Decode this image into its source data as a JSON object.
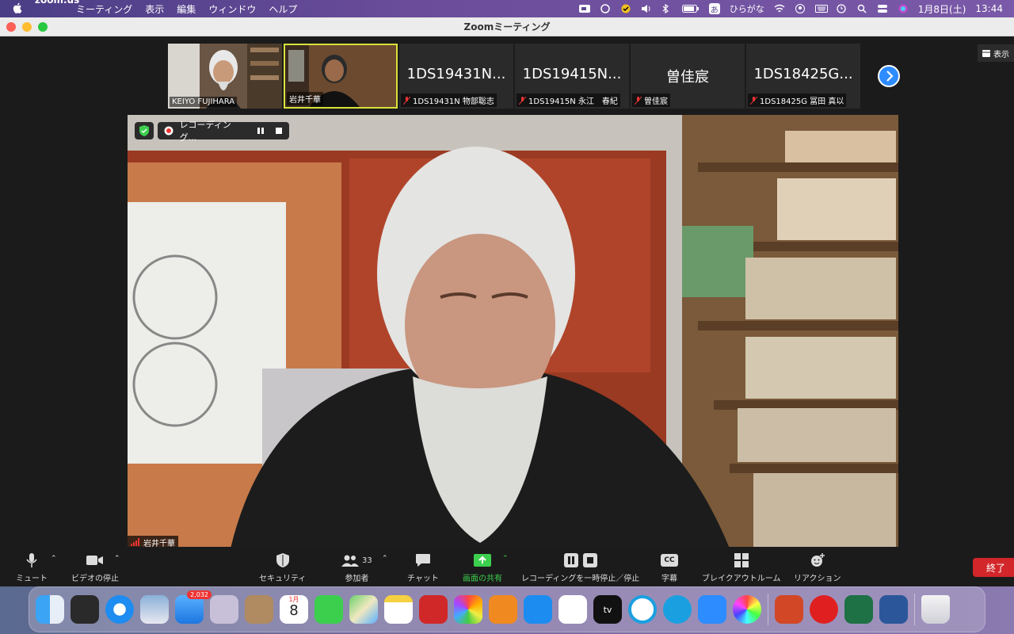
{
  "menubar": {
    "app": "zoom.us",
    "menus": [
      "ミーティング",
      "表示",
      "編集",
      "ウィンドウ",
      "ヘルプ"
    ],
    "input_mode": "ひらがな",
    "input_mode_icon": "あ",
    "date": "1月8日(土)",
    "time": "13:44"
  },
  "window": {
    "title": "Zoomミーティング"
  },
  "view_button": {
    "label": "表示"
  },
  "participants": [
    {
      "label": "KEIYO FUJIHARA",
      "video": true,
      "muted": false,
      "active": false
    },
    {
      "label": "岩井千華",
      "video": true,
      "muted": false,
      "active": true
    },
    {
      "big": "1DS19431N...",
      "label": "1DS19431N 物部聡志",
      "video": false,
      "muted": true
    },
    {
      "big": "1DS19415N...",
      "label": "1DS19415N 永江　春紀",
      "video": false,
      "muted": true
    },
    {
      "big": "曽佳宸",
      "label": "曽佳宸",
      "video": false,
      "muted": true
    },
    {
      "big": "1DS18425G...",
      "label": "1DS18425G 冨田 真以",
      "video": false,
      "muted": true
    }
  ],
  "recording": {
    "label": "レコーディング..."
  },
  "speaker": {
    "name": "岩井千華"
  },
  "controls": {
    "mute": "ミュート",
    "video": "ビデオの停止",
    "security": "セキュリティ",
    "participants": "参加者",
    "participant_count": "33",
    "chat": "チャット",
    "share": "画面の共有",
    "recording": "レコーディングを一時停止／停止",
    "captions": "字幕",
    "captions_icon": "CC",
    "breakout": "ブレイクアウトルーム",
    "reactions": "リアクション",
    "end": "終了"
  },
  "dock": {
    "mail_badge": "2,032",
    "calendar_month": "1月",
    "calendar_day": "8",
    "tv_label": "tv"
  },
  "colors": {
    "zoom_blue": "#2d8cff",
    "share_green": "#3ccf4e",
    "end_red": "#d2262a",
    "active_border": "#d8e23a"
  }
}
